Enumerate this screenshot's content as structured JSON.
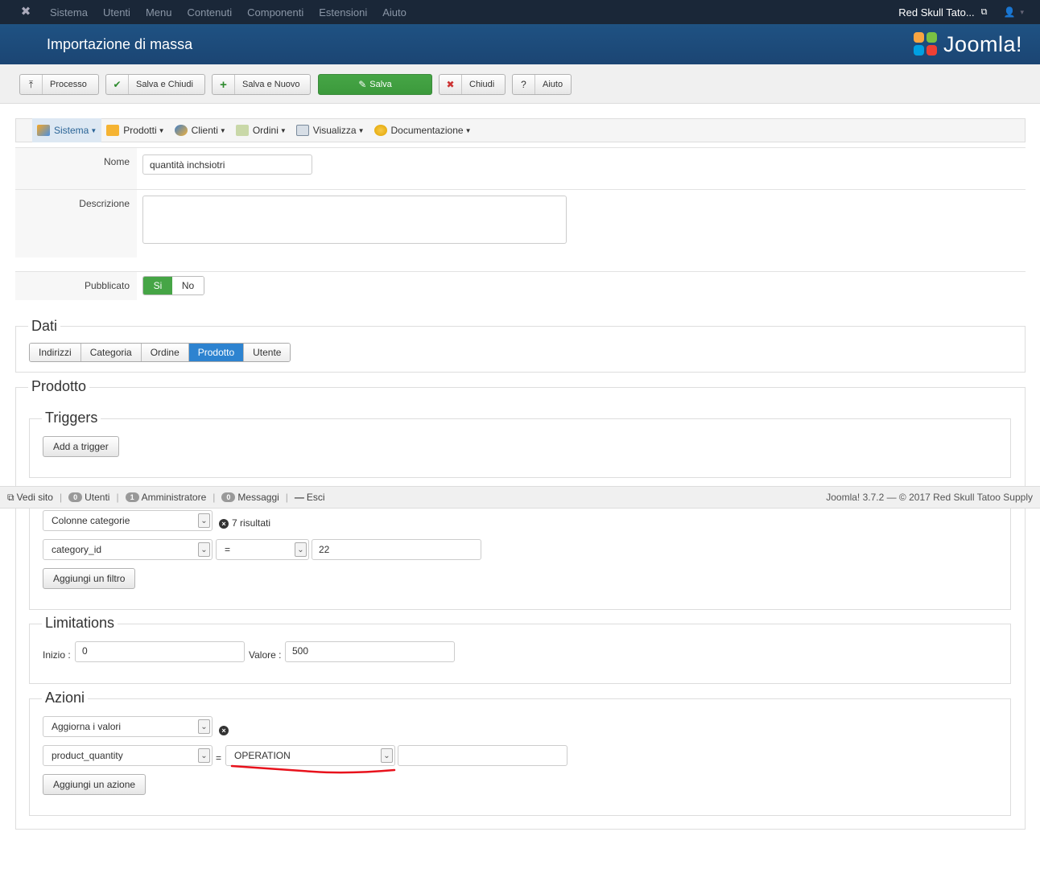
{
  "topnav": {
    "menu": [
      "Sistema",
      "Utenti",
      "Menu",
      "Contenuti",
      "Componenti",
      "Estensioni",
      "Aiuto"
    ],
    "user_label": "Red Skull Tato...",
    "icons": {
      "logo": "joomla-icon",
      "external": "external-link-icon",
      "user": "user-icon"
    }
  },
  "header": {
    "title": "Importazione di massa",
    "brand": "Joomla!"
  },
  "toolbar": {
    "process": "Processo",
    "save_close": "Salva e Chiudi",
    "save_new": "Salva e Nuovo",
    "save": "Salva",
    "close": "Chiudi",
    "help": "Aiuto"
  },
  "submenu": {
    "items": [
      {
        "label": "Sistema",
        "icon": "wrench-icon"
      },
      {
        "label": "Prodotti",
        "icon": "products-icon"
      },
      {
        "label": "Clienti",
        "icon": "customers-icon"
      },
      {
        "label": "Ordini",
        "icon": "orders-icon"
      },
      {
        "label": "Visualizza",
        "icon": "display-icon"
      },
      {
        "label": "Documentazione",
        "icon": "documentation-icon"
      }
    ]
  },
  "form": {
    "name_label": "Nome",
    "name_value": "quantità inchsiotri",
    "description_label": "Descrizione",
    "description_value": "",
    "published_label": "Pubblicato",
    "published_yes": "Si",
    "published_no": "No"
  },
  "dati": {
    "legend": "Dati",
    "tabs": [
      "Indirizzi",
      "Categoria",
      "Ordine",
      "Prodotto",
      "Utente"
    ],
    "active_tab": "Prodotto"
  },
  "prodotto": {
    "legend": "Prodotto",
    "triggers": {
      "legend": "Triggers",
      "add_button": "Add a trigger"
    },
    "filters": {
      "column_select": "Colonne categorie",
      "results": "7 risultati",
      "field_select": "category_id",
      "operator_select": "=",
      "value": "22",
      "add_button": "Aggiungi un filtro"
    },
    "limitations": {
      "legend": "Limitations",
      "start_label": "Inizio :",
      "start_value": "0",
      "value_label": "Valore :",
      "value_value": "500"
    },
    "actions": {
      "legend": "Azioni",
      "action_select": "Aggiorna i valori",
      "field_select": "product_quantity",
      "equals": "=",
      "operation_select": "OPERATION",
      "operation_value": "",
      "add_button": "Aggiungi un azione"
    }
  },
  "statusbar": {
    "view_site": "Vedi sito",
    "users_count": "0",
    "users_label": "Utenti",
    "admins_count": "1",
    "admins_label": "Amministratore",
    "messages_count": "0",
    "messages_label": "Messaggi",
    "logout": "Esci",
    "version": "Joomla! 3.7.2 — © 2017 Red Skull Tatoo Supply"
  },
  "annotation": {
    "color": "#e8121c"
  }
}
